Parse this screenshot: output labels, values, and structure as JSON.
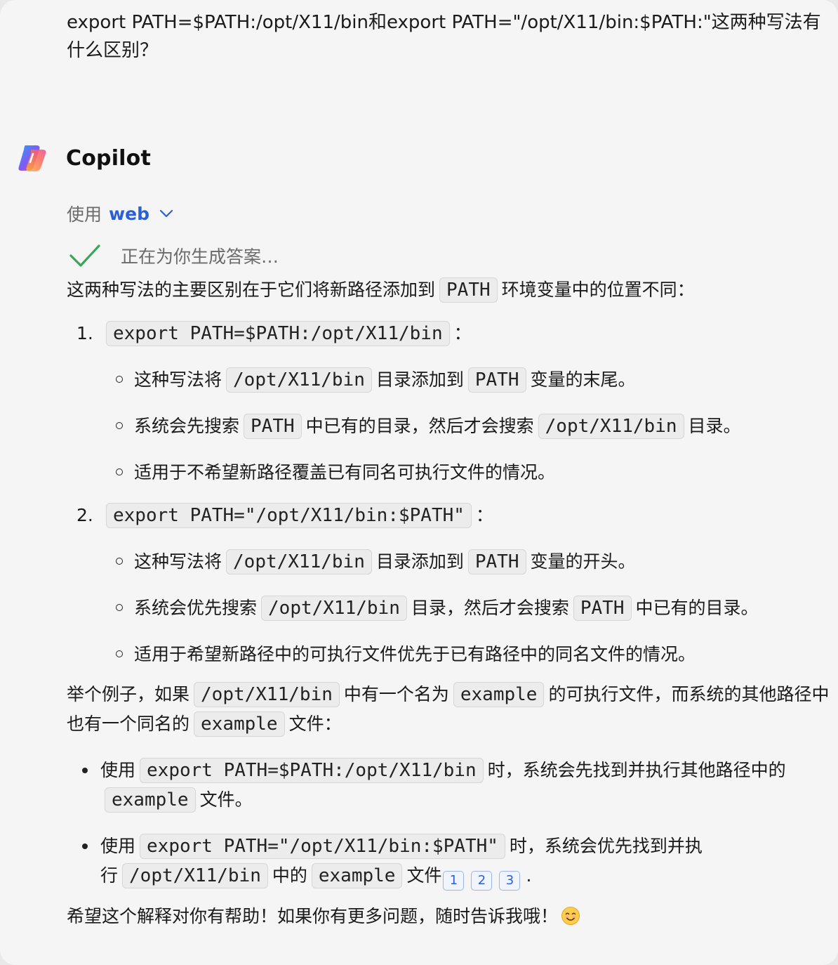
{
  "user_message": "export PATH=$PATH:/opt/X11/bin和export PATH=\"/opt/X11/bin:$PATH:\"这两种写法有什么区别？",
  "bot": {
    "name": "Copilot",
    "logo_icon": "copilot-logo-icon"
  },
  "source": {
    "prefix": "使用",
    "link": "web"
  },
  "status": {
    "text": "正在为你生成答案…"
  },
  "answer": {
    "intro": [
      "这两种写法的主要区别在于它们将新路径添加到",
      "PATH",
      "环境变量中的位置不同："
    ],
    "items": [
      {
        "num": "1.",
        "code": "export PATH=$PATH:/opt/X11/bin",
        "suffix": "：",
        "subs": [
          [
            "这种写法将",
            "/opt/X11/bin",
            "目录添加到",
            "PATH",
            "变量的末尾。"
          ],
          [
            "系统会先搜索",
            "PATH",
            "中已有的目录，然后才会搜索",
            "/opt/X11/bin",
            "目录。"
          ],
          [
            "适用于不希望新路径覆盖已有同名可执行文件的情况。"
          ]
        ]
      },
      {
        "num": "2.",
        "code": "export PATH=\"/opt/X11/bin:$PATH\"",
        "suffix": "：",
        "subs": [
          [
            "这种写法将",
            "/opt/X11/bin",
            "目录添加到",
            "PATH",
            "变量的开头。"
          ],
          [
            "系统会优先搜索",
            "/opt/X11/bin",
            "目录，然后才会搜索",
            "PATH",
            "中已有的目录。"
          ],
          [
            "适用于希望新路径中的可执行文件优先于已有路径中的同名文件的情况。"
          ]
        ]
      }
    ],
    "example": [
      "举个例子，如果",
      "/opt/X11/bin",
      "中有一个名为",
      "example",
      "的可执行文件，而系统的其他路径中也有一个同名的",
      "example",
      "文件："
    ],
    "bullets": [
      [
        "使用",
        "export PATH=$PATH:/opt/X11/bin",
        "时，系统会先找到并执行其他路径中的",
        "example",
        "文件。"
      ],
      [
        "使用",
        "export PATH=\"/opt/X11/bin:$PATH\"",
        "时，系统会优先找到并执行",
        "/opt/X11/bin",
        "中的",
        "example",
        "文件"
      ]
    ],
    "citations": [
      "1",
      "2",
      "3"
    ],
    "bullet2_end": ".",
    "closing": "希望这个解释对你有帮助！如果你有更多问题，随时告诉我哦！",
    "closing_emoji": "smiling-face-icon"
  }
}
